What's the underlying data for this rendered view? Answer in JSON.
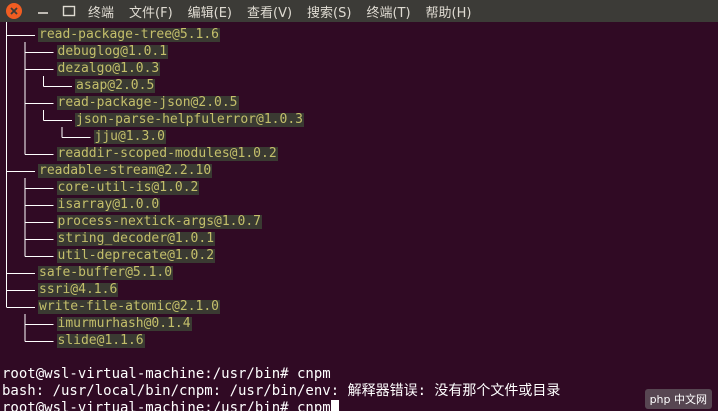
{
  "menubar": {
    "items": [
      "终端",
      "文件(F)",
      "编辑(E)",
      "查看(V)",
      "搜索(S)",
      "终端(T)",
      "帮助(H)"
    ]
  },
  "tree": {
    "nodes": [
      "read-package-tree@5.1.6",
      "debuglog@1.0.1",
      "dezalgo@1.0.3",
      "asap@2.0.5",
      "read-package-json@2.0.5",
      "json-parse-helpfulerror@1.0.3",
      "jju@1.3.0",
      "readdir-scoped-modules@1.0.2",
      "readable-stream@2.2.10",
      "core-util-is@1.0.2",
      "isarray@1.0.0",
      "process-nextick-args@1.0.7",
      "string_decoder@1.0.1",
      "util-deprecate@1.0.2",
      "safe-buffer@5.1.0",
      "ssri@4.1.6",
      "write-file-atomic@2.1.0",
      "imurmurhash@0.1.4",
      "slide@1.1.6"
    ]
  },
  "shell": {
    "lines": [
      "root@wsl-virtual-machine:/usr/bin# cnpm",
      "bash: /usr/local/bin/cnpm: /usr/bin/env: 解释器错误: 没有那个文件或目录",
      "root@wsl-virtual-machine:/usr/bin# cnpm"
    ]
  },
  "watermark": "php 中文网",
  "colors": {
    "background": "#300a24",
    "package_text": "#c4bf6b",
    "package_highlight": "#3a3a32",
    "tree_lines": "#ffffff",
    "menubar": "#3c3b37",
    "close_button": "#f15d22"
  }
}
